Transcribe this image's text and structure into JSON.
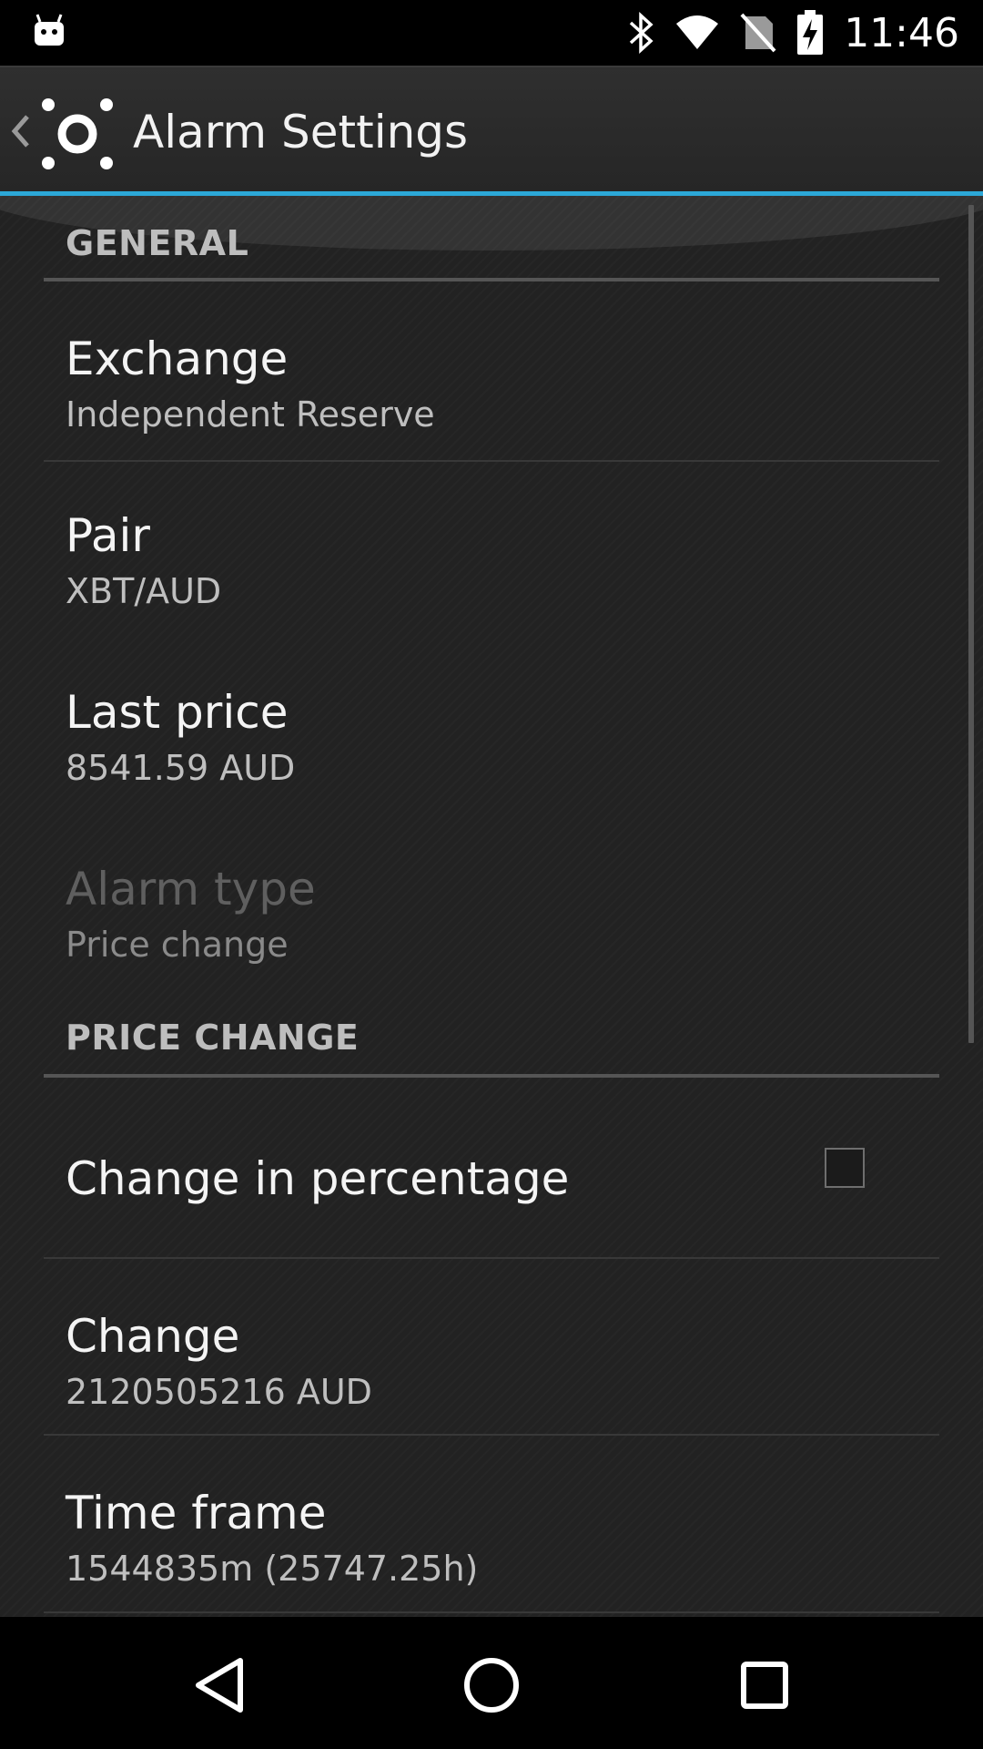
{
  "status_bar": {
    "time": "11:46",
    "icons": [
      "android-notification-icon",
      "bluetooth-icon",
      "wifi-icon",
      "no-sim-icon",
      "battery-charging-icon"
    ]
  },
  "action_bar": {
    "title": "Alarm Settings",
    "icons": [
      "back-chevron-icon",
      "app-logo-icon"
    ]
  },
  "accent_color": "#2ca8d8",
  "general": {
    "header": "GENERAL",
    "exchange": {
      "title": "Exchange",
      "summary": "Independent Reserve"
    },
    "pair": {
      "title": "Pair",
      "summary": "XBT/AUD"
    },
    "last_price": {
      "title": "Last price",
      "summary": "8541.59 AUD"
    },
    "alarm_type": {
      "title": "Alarm type",
      "summary": "Price change",
      "enabled": false
    }
  },
  "price_change": {
    "header": "PRICE CHANGE",
    "change_in_percentage": {
      "title": "Change in percentage",
      "checked": false
    },
    "change": {
      "title": "Change",
      "summary": "2120505216 AUD"
    },
    "time_frame": {
      "title": "Time frame",
      "summary": "1544835m (25747.25h)"
    }
  },
  "nav_bar": {
    "icons": [
      "back-triangle-icon",
      "home-circle-icon",
      "recents-square-icon"
    ]
  }
}
